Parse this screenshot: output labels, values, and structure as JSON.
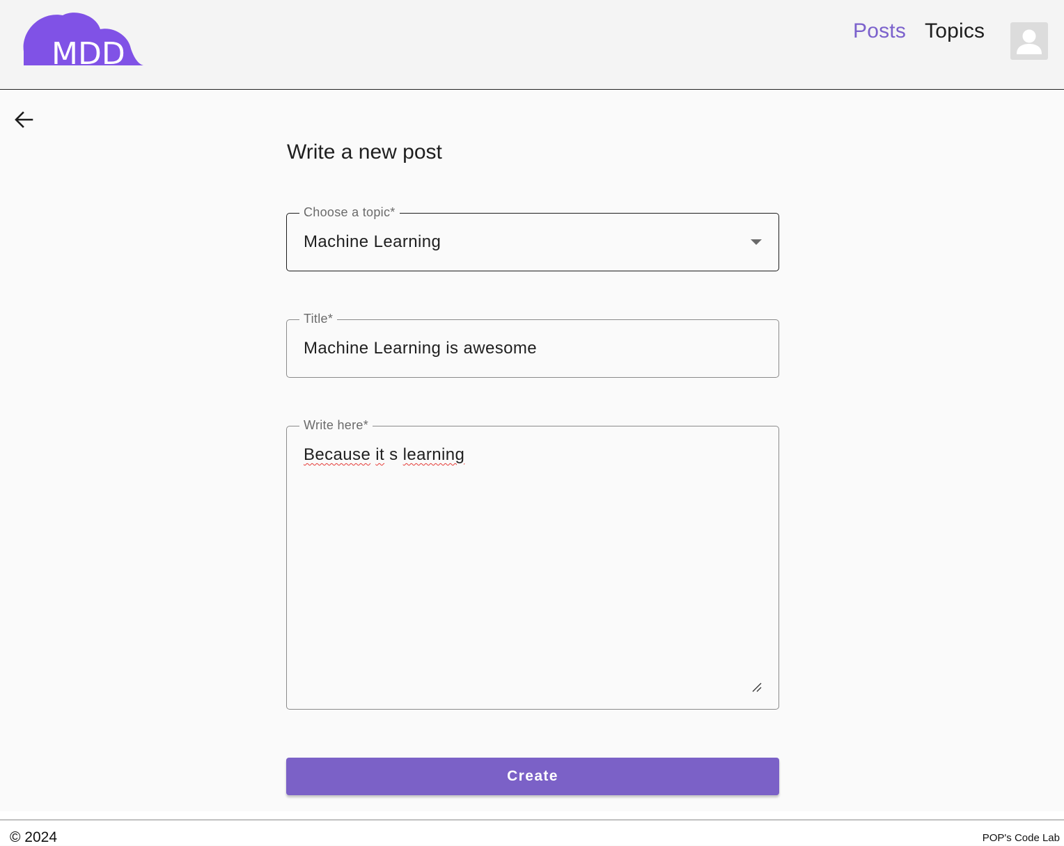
{
  "header": {
    "logo_text": "MDD",
    "nav": {
      "posts_label": "Posts",
      "topics_label": "Topics"
    },
    "avatar_icon": "user-avatar-icon"
  },
  "colors": {
    "brand_purple": "#7b61cc",
    "button_purple": "#7b61c7",
    "logo_purple": "#8052e6"
  },
  "back_icon": "arrow-left-icon",
  "form": {
    "title": "Write a new post",
    "topic": {
      "label": "Choose a topic*",
      "value": "Machine Learning"
    },
    "title_field": {
      "label": "Title*",
      "value": "Machine Learning is awesome"
    },
    "content": {
      "label": "Write here*",
      "words": [
        "Because",
        "it",
        "s",
        "learning"
      ]
    },
    "submit_label": "Create"
  },
  "footer": {
    "copyright": "© 2024",
    "credit": "POP's Code Lab"
  }
}
